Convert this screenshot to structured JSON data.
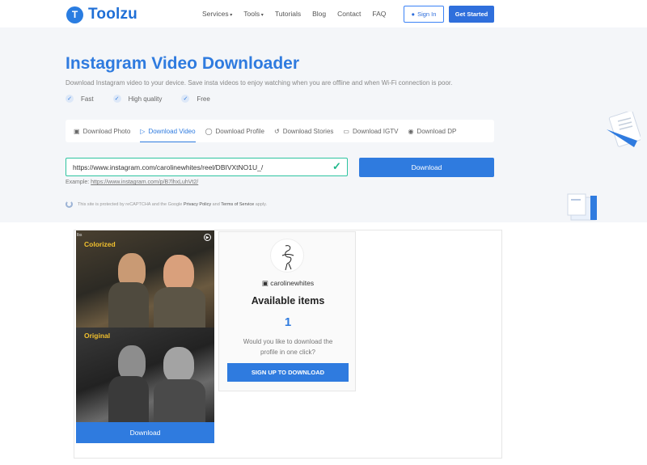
{
  "header": {
    "logo_mark": "T",
    "logo_text": "Toolzu",
    "nav": [
      "Services",
      "Tools",
      "Tutorials",
      "Blog",
      "Contact",
      "FAQ"
    ],
    "signin_label": "Sign In",
    "start_label": "Get Started"
  },
  "hero": {
    "title": "Instagram Video Downloader",
    "description": "Download Instagram video to your device. Save insta videos to enjoy watching when you are offline and when Wi-Fi connection is poor.",
    "features": [
      "Fast",
      "High quality",
      "Free"
    ]
  },
  "tabs": [
    {
      "label": "Download Photo",
      "icon": "photo-icon"
    },
    {
      "label": "Download Video",
      "icon": "play-circle-icon",
      "active": true
    },
    {
      "label": "Download Profile",
      "icon": "profile-icon"
    },
    {
      "label": "Download Stories",
      "icon": "history-icon"
    },
    {
      "label": "Download IGTV",
      "icon": "tv-icon"
    },
    {
      "label": "Download DP",
      "icon": "user-circle-icon"
    }
  ],
  "form": {
    "url_value": "https://www.instagram.com/carolinewhites/reel/DBIVXtNO1U_/",
    "download_label": "Download",
    "example_prefix": "Example:",
    "example_link": "https://www.instagram.com/p/B7lhxLuhVt2/"
  },
  "captcha": {
    "text_before": "This site is protected by reCAPTCHA and the Google",
    "privacy": "Privacy Policy",
    "and": "and",
    "terms": "Terms of Service",
    "text_after": "apply."
  },
  "result": {
    "video": {
      "tag": "lbs",
      "label_top": "Colorized",
      "label_bottom": "Original",
      "download_label": "Download"
    },
    "profile": {
      "username": "carolinewhites",
      "available_label": "Available items",
      "count": "1",
      "question": "Would you like to download the profile in one click?",
      "signup_label": "SIGN UP TO DOWNLOAD"
    }
  },
  "colors": {
    "accent": "#2f7bdf",
    "success": "#1fb88a",
    "hero_bg": "#f4f6f9"
  }
}
